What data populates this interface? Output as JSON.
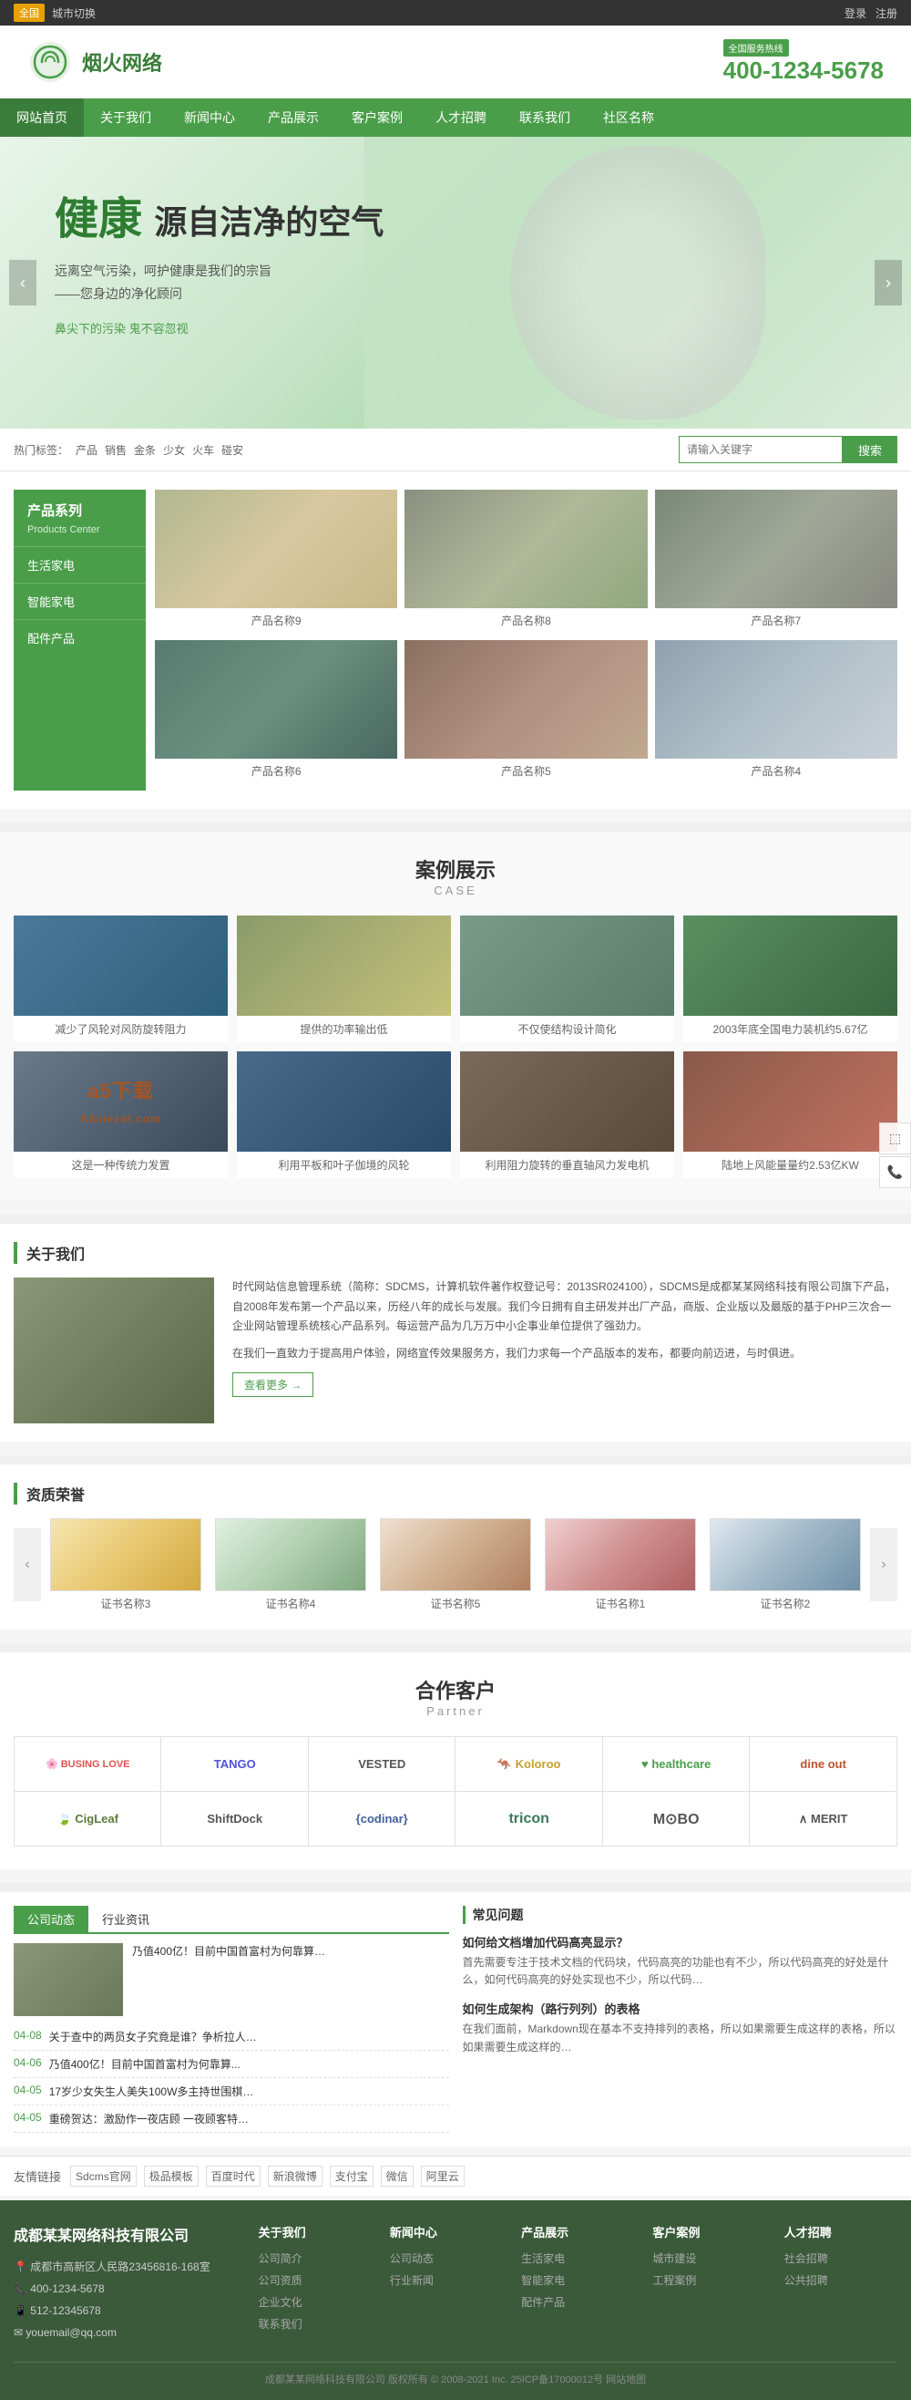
{
  "topbar": {
    "region": "全国",
    "switch_label": "城市切换",
    "login": "登录",
    "register": "注册"
  },
  "header": {
    "logo_text": "烟火网络",
    "service_badge": "全国服务热线",
    "hotline": "400-1234-5678"
  },
  "nav": {
    "items": [
      {
        "label": "网站首页",
        "active": true
      },
      {
        "label": "关于我们"
      },
      {
        "label": "新闻中心"
      },
      {
        "label": "产品展示"
      },
      {
        "label": "客户案例"
      },
      {
        "label": "人才招聘"
      },
      {
        "label": "联系我们"
      },
      {
        "label": "社区名称"
      }
    ]
  },
  "hero": {
    "title_part1": "健康",
    "title_part2": "源自洁净的空气",
    "subtitle1": "远离空气污染，呵护健康是我们的宗旨",
    "subtitle2": "——您身边的净化顾问",
    "link": "鼻尖下的污染  鬼不容忽视"
  },
  "search": {
    "hot_label": "热门标签：",
    "tags": [
      "产品",
      "销售",
      "金条",
      "少女",
      "火车",
      "碰安"
    ],
    "placeholder": "请输入关键字",
    "button": "搜索"
  },
  "products": {
    "sidebar_title": "产品系列",
    "sidebar_subtitle": "Products Center",
    "menu": [
      "生活家电",
      "智能家电",
      "配件产品"
    ],
    "items": [
      {
        "name": "产品名称9",
        "class": "p1"
      },
      {
        "name": "产品名称8",
        "class": "p2"
      },
      {
        "name": "产品名称7",
        "class": "p3"
      },
      {
        "name": "产品名称6",
        "class": "p4"
      },
      {
        "name": "产品名称5",
        "class": "p5"
      },
      {
        "name": "产品名称4",
        "class": "p6"
      }
    ]
  },
  "cases": {
    "title": "案例展示",
    "subtitle": "CASE",
    "items": [
      {
        "caption": "减少了风轮对风防旋转阻力",
        "class": "c1"
      },
      {
        "caption": "提供的功率输出低",
        "class": "c2"
      },
      {
        "caption": "不仅使结构设计简化",
        "class": "c3"
      },
      {
        "caption": "2003年底全国电力装机约5.67亿",
        "class": "c4"
      },
      {
        "caption": "这是一种传统力发置",
        "class": "c5"
      },
      {
        "caption": "利用平板和叶子伽境的风轮",
        "class": "c6"
      },
      {
        "caption": "利用阻力旋转的垂直轴风力发电机",
        "class": "c7"
      },
      {
        "caption": "陆地上风能量量约2.53亿KW",
        "class": "c8"
      }
    ]
  },
  "about": {
    "label": "关于我们",
    "text1": "时代网站信息管理系统（简称：SDCMS，计算机软件著作权登记号：2013SR024100），SDCMS是成都某某网络科技有限公司旗下产品，自2008年发布第一个产品以来，历经八年的成长与发展。我们今日拥有自主研发并出厂产品，商版、企业版以及最版的基于PHP三次合一企业网站管理系统核心产品系列。每运营产品为几万万中小企事业单位提供了强劲力。",
    "text2": "在我们一直致力于提高用户体验，网络宣传效果服务方，我们力求每一个产品版本的发布，都要向前迈进，与时俱进。",
    "more": "查看更多 →"
  },
  "awards": {
    "label": "资质荣誉",
    "items": [
      {
        "name": "证书名称3",
        "class": "cert1"
      },
      {
        "name": "证书名称4",
        "class": "cert2"
      },
      {
        "name": "证书名称5",
        "class": "cert3"
      },
      {
        "name": "证书名称1",
        "class": "cert4"
      },
      {
        "name": "证书名称2",
        "class": "cert5"
      }
    ]
  },
  "partners": {
    "title": "合作客户",
    "subtitle": "Partner",
    "items": [
      {
        "name": "BUSING LOVE",
        "style": "p-red"
      },
      {
        "name": "TANGO",
        "style": "p-blue"
      },
      {
        "name": "VESTED",
        "style": ""
      },
      {
        "name": "Koloroo",
        "style": "p-green"
      },
      {
        "name": "healthcare",
        "style": "p-green"
      },
      {
        "name": "dine out",
        "style": ""
      },
      {
        "name": "CigLeaf",
        "style": ""
      },
      {
        "name": "ShiftDock",
        "style": ""
      },
      {
        "name": "codinar",
        "style": ""
      },
      {
        "name": "tricon",
        "style": ""
      },
      {
        "name": "M⊙BO",
        "style": ""
      },
      {
        "name": "MERIT",
        "style": ""
      }
    ]
  },
  "news": {
    "tabs": [
      "公司动态",
      "行业资讯"
    ],
    "thumb_caption": "乃值400亿！目前中国首富村为何靠算…",
    "items": [
      {
        "date_month": "04-08",
        "title": "关于查中的两员女子究竟是谁？争析拉人…",
        "content": ""
      },
      {
        "date_month": "04-06",
        "title": "乃值400亿！目前中国首富村为何靠算…",
        "content": ""
      },
      {
        "date_month": "04-05",
        "title": "17岁少女失生人美失100W多主持世围棋…",
        "content": ""
      },
      {
        "date_month": "04-05",
        "title": "重磅贺达：激励作一夜店顾 一夜顾客特…",
        "content": ""
      }
    ]
  },
  "qa": {
    "label": "常见问题",
    "items": [
      {
        "question": "如何给文档增加代码高亮显示？",
        "answer": "首先需要专注于技术文档的代码块，代码高亮的功能也有不少，所以代码高亮的好处是什么…"
      },
      {
        "question": "如何生成架构（路行列列）的表格",
        "answer": "在我们面前，Markdown现在基本不支持排列的表格，所以如果需要生成这样的…"
      }
    ]
  },
  "links": {
    "label": "友情链接",
    "items": [
      "Sdcms官网",
      "极品模板",
      "百度时代",
      "新浪微博",
      "支付宝",
      "微信",
      "阿里云"
    ]
  },
  "footer": {
    "company_name": "成都某某网络科技有限公司",
    "address": "成都市高新区人民路23456816-168室",
    "tel": "400-1234-5678",
    "mobile": "512-12345678",
    "email": "youemail@qq.com",
    "columns": [
      {
        "title": "关于我们",
        "links": [
          "公司简介",
          "公司资质",
          "企业文化",
          "联系我们"
        ]
      },
      {
        "title": "新闻中心",
        "links": [
          "公司动态",
          "行业新闻"
        ]
      },
      {
        "title": "产品展示",
        "links": [
          "生活家电",
          "智能家电",
          "配件产品"
        ]
      },
      {
        "title": "客户案例",
        "links": [
          "城市建设",
          "工程案例"
        ]
      },
      {
        "title": "人才招聘",
        "links": [
          "社会招聘",
          "公共招聘"
        ]
      }
    ],
    "copyright": "成都某某网络科技有限公司  版权所有 © 2008-2021 Inc.   25ICP备17000012号   网站地图"
  }
}
